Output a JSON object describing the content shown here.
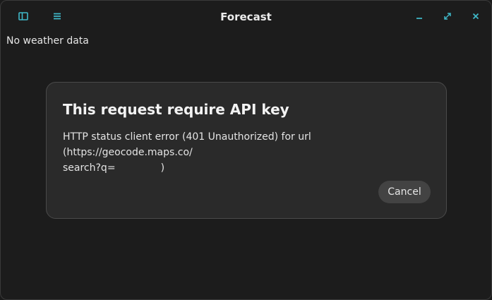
{
  "window": {
    "title": "Forecast",
    "controls": {
      "sidebar_icon": "sidebar-toggle-icon",
      "menu_icon": "hamburger-menu-icon",
      "minimize_icon": "minimize-icon",
      "maximize_icon": "maximize-icon",
      "close_icon": "close-icon"
    },
    "accent_color": "#3fb8c8"
  },
  "main": {
    "status_text": "No weather data"
  },
  "dialog": {
    "title": "This request require API key",
    "body_line1": "HTTP status client error (401 Unauthorized) for url (https://geocode.maps.co/",
    "body_line2_prefix": "search?q=",
    "body_line2_suffix": ")",
    "cancel_label": "Cancel"
  }
}
